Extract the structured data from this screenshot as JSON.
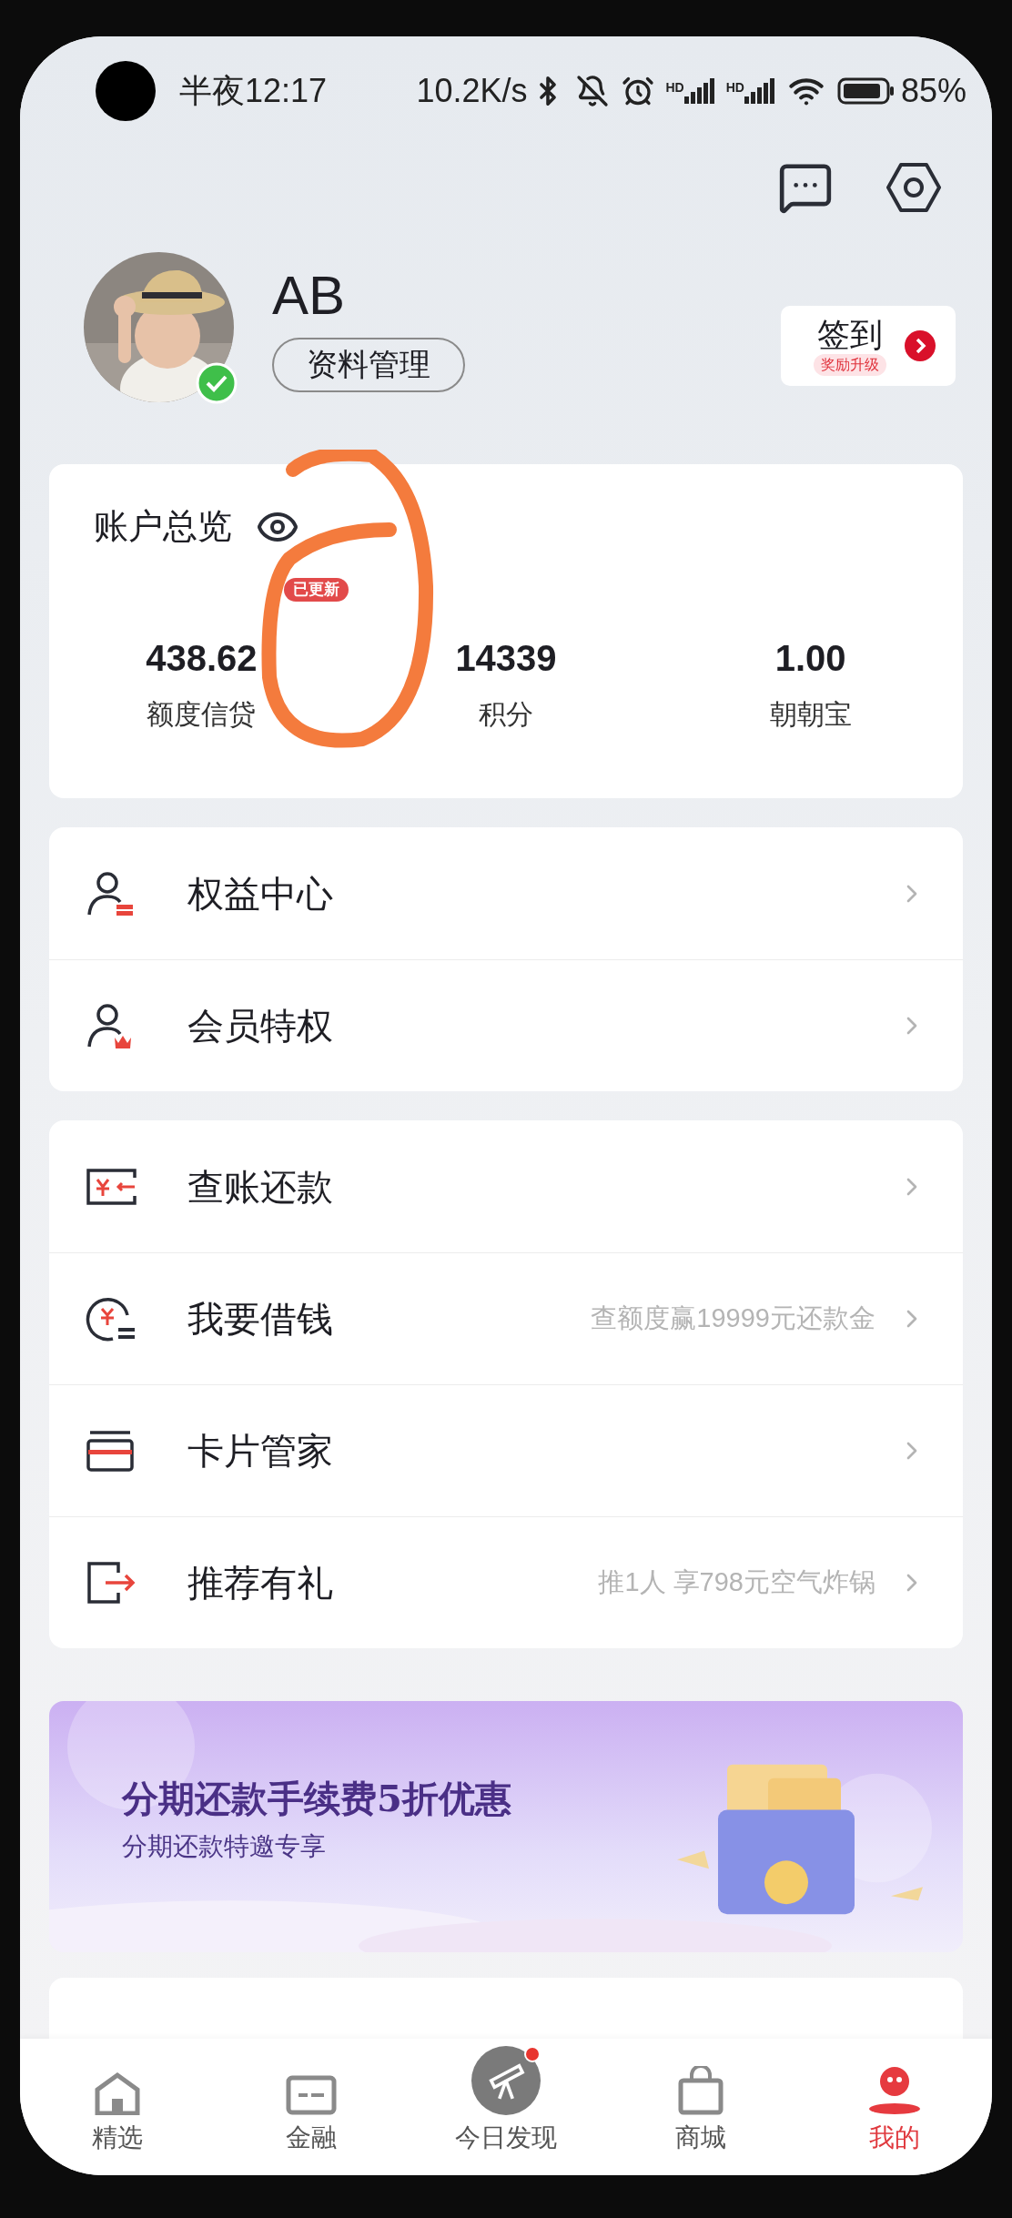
{
  "status_bar": {
    "time": "半夜12:17",
    "net_speed": "10.2K/s",
    "sim_labels": [
      "HD",
      "HD"
    ],
    "battery": "85%"
  },
  "profile": {
    "name": "AB",
    "manage_button": "资料管理",
    "verified": true,
    "checkin": {
      "label": "签到",
      "badge": "奖励升级"
    }
  },
  "account": {
    "title": "账户总览",
    "stats": [
      {
        "value": "438.62",
        "label": "额度信贷",
        "badge": "已更新"
      },
      {
        "value": "14339",
        "label": "积分"
      },
      {
        "value": "1.00",
        "label": "朝朝宝"
      }
    ]
  },
  "menu_groups": [
    [
      {
        "kind": "benefits",
        "label": "权益中心"
      },
      {
        "kind": "member",
        "label": "会员特权"
      }
    ],
    [
      {
        "kind": "bill",
        "label": "查账还款"
      },
      {
        "kind": "loan",
        "label": "我要借钱",
        "hint": "查额度赢19999元还款金"
      },
      {
        "kind": "card",
        "label": "卡片管家"
      },
      {
        "kind": "refer",
        "label": "推荐有礼",
        "hint": "推1人 享798元空气炸锅"
      }
    ]
  ],
  "banner": {
    "title": "分期还款手续费5折优惠",
    "subtitle": "分期还款特邀专享"
  },
  "tabs": [
    {
      "kind": "home",
      "label": "精选",
      "selected": false,
      "dot": false
    },
    {
      "kind": "finance",
      "label": "金融",
      "selected": false,
      "dot": false
    },
    {
      "kind": "discover",
      "label": "今日发现",
      "selected": false,
      "dot": true
    },
    {
      "kind": "mall",
      "label": "商城",
      "selected": false,
      "dot": false
    },
    {
      "kind": "mine",
      "label": "我的",
      "selected": true,
      "dot": false
    }
  ]
}
